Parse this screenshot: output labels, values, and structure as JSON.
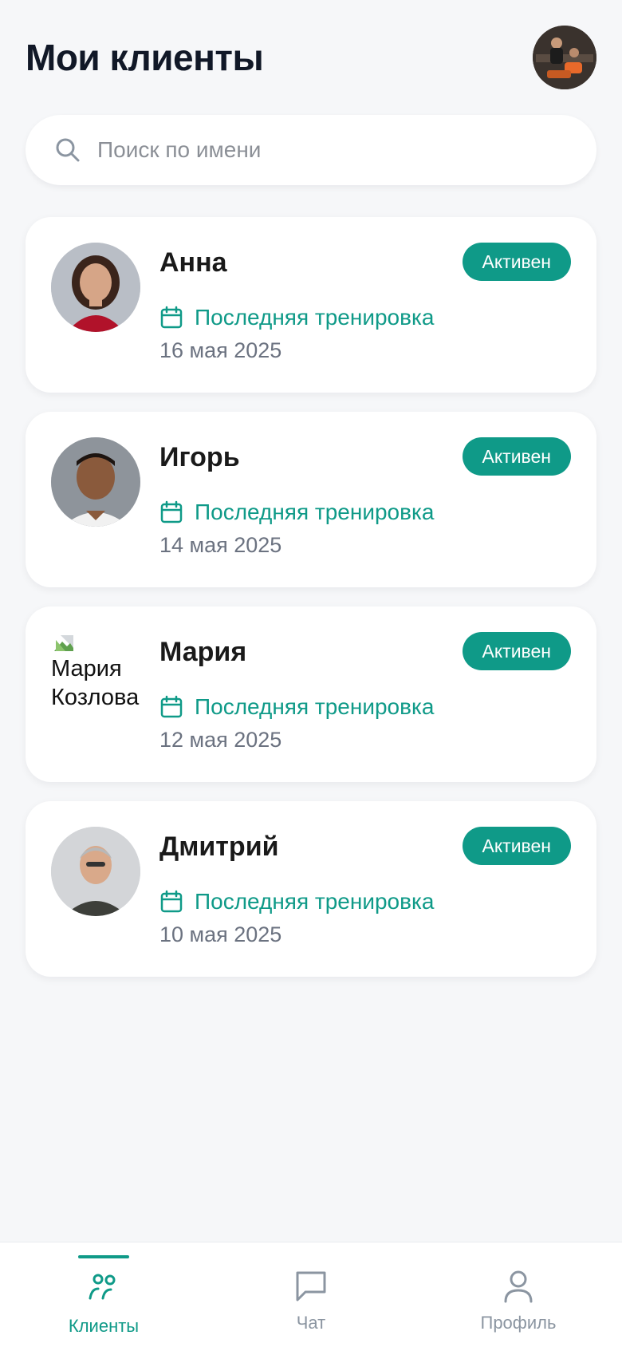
{
  "header": {
    "title": "Мои клиенты"
  },
  "search": {
    "placeholder": "Поиск по имени"
  },
  "clients": [
    {
      "name": "Анна",
      "status": "Активен",
      "last_training_label": "Последняя тренировка",
      "date": "16 мая 2025"
    },
    {
      "name": "Игорь",
      "status": "Активен",
      "last_training_label": "Последняя тренировка",
      "date": "14 мая 2025"
    },
    {
      "name": "Мария",
      "status": "Активен",
      "last_training_label": "Последняя тренировка",
      "date": "12 мая 2025",
      "avatar_alt": "Мария Козлова"
    },
    {
      "name": "Дмитрий",
      "status": "Активен",
      "last_training_label": "Последняя тренировка",
      "date": "10 мая 2025"
    }
  ],
  "nav": {
    "items": [
      {
        "label": "Клиенты",
        "icon": "users-icon",
        "active": true
      },
      {
        "label": "Чат",
        "icon": "chat-icon",
        "active": false
      },
      {
        "label": "Профиль",
        "icon": "user-icon",
        "active": false
      }
    ]
  },
  "colors": {
    "accent": "#0f9a88",
    "background": "#f6f7f9",
    "title": "#111827",
    "muted": "#6b7280"
  }
}
